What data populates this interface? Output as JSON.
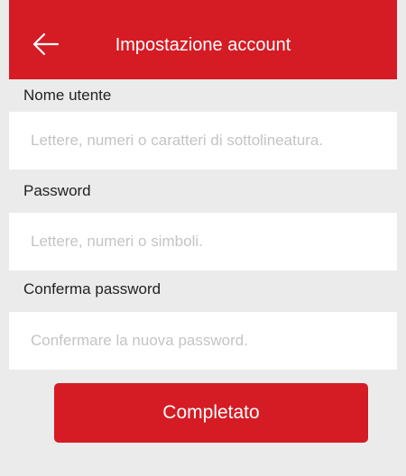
{
  "colors": {
    "brand": "#d51b24",
    "background": "#ebebeb",
    "field": "#ffffff",
    "placeholder": "#c4c4c4"
  },
  "header": {
    "back_icon": "arrow-left-icon",
    "title": "Impostazione account"
  },
  "form": {
    "username": {
      "label": "Nome utente",
      "value": "",
      "placeholder": "Lettere, numeri o caratteri di sottolineatura."
    },
    "password": {
      "label": "Password",
      "value": "",
      "placeholder": "Lettere, numeri o simboli."
    },
    "confirm_password": {
      "label": "Conferma password",
      "value": "",
      "placeholder": "Confermare la nuova password."
    }
  },
  "submit": {
    "label": "Completato"
  }
}
